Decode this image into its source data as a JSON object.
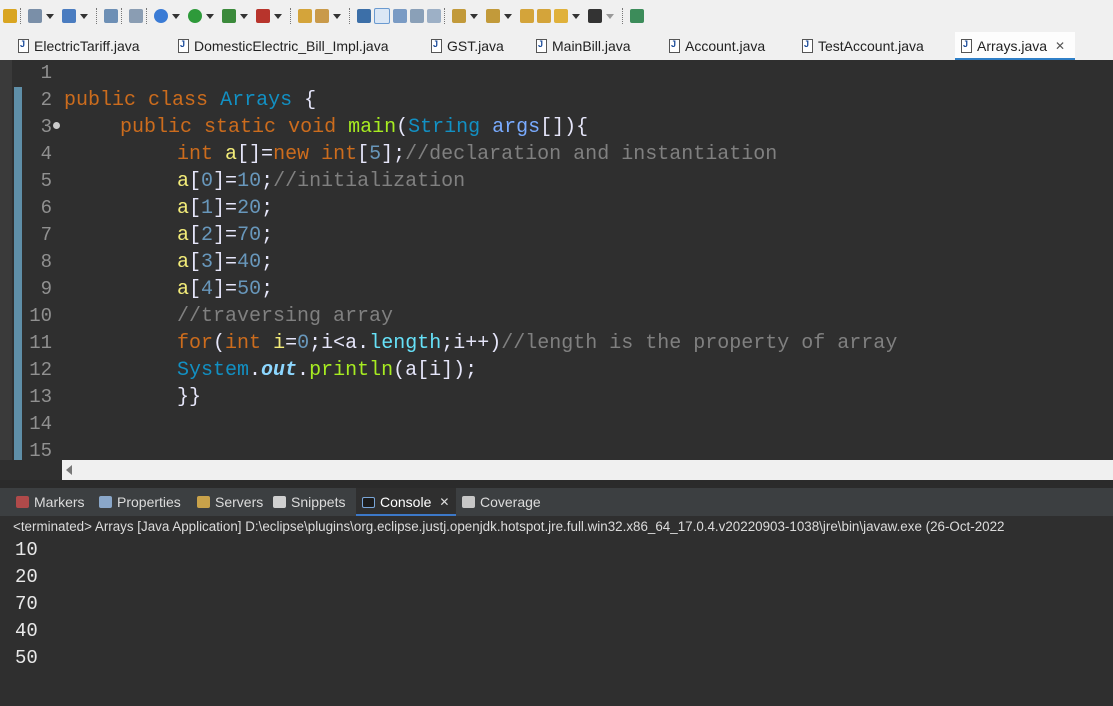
{
  "toolbar": {
    "icons": [
      "toggle-icon",
      "new-icon",
      "publish-icon",
      "server-icon",
      "web-service-icon",
      "debug-icon",
      "run-icon",
      "coverage-icon",
      "external-tools-icon",
      "open-folder-icon",
      "pencil-icon",
      "open-type-icon",
      "highlight-icon",
      "toggle-mark-icon",
      "block-select-icon",
      "pilcrow-icon",
      "next-annotation-icon",
      "prev-annotation-icon",
      "last-edit-icon",
      "back-icon",
      "forward-icon",
      "pin-editor-icon"
    ]
  },
  "editor_tabs": [
    {
      "label": "ElectricTariff.java"
    },
    {
      "label": "DomesticElectric_Bill_Impl.java"
    },
    {
      "label": "GST.java"
    },
    {
      "label": "MainBill.java"
    },
    {
      "label": "Account.java"
    },
    {
      "label": "TestAccount.java"
    },
    {
      "label": "Arrays.java",
      "active": true
    }
  ],
  "editor": {
    "line_numbers": [
      "1",
      "2",
      "3",
      "4",
      "5",
      "6",
      "7",
      "8",
      "9",
      "10",
      "11",
      "12",
      "13",
      "14",
      "15"
    ],
    "code": {
      "l2": {
        "kw1": "public",
        "kw2": "class",
        "name": "Arrays",
        "brace": "{"
      },
      "l3": {
        "kw1": "public",
        "kw2": "static",
        "kw3": "void",
        "method": "main",
        "p1": "(",
        "type": "String",
        "arg": "args",
        "rest": "[]){"
      },
      "l4": {
        "kw1": "int",
        "var": "a",
        "p1": "[]=",
        "kw2": "new",
        "kw3": "int",
        "p2": "[",
        "num": "5",
        "p3": "];",
        "cmt": "//declaration and instantiation"
      },
      "l5": {
        "var": "a",
        "p1": "[",
        "idx": "0",
        "p2": "]=",
        "num": "10",
        "p3": ";",
        "cmt": "//initialization"
      },
      "l6": {
        "var": "a",
        "p1": "[",
        "idx": "1",
        "p2": "]=",
        "num": "20",
        "p3": ";"
      },
      "l7": {
        "var": "a",
        "p1": "[",
        "idx": "2",
        "p2": "]=",
        "num": "70",
        "p3": ";"
      },
      "l8": {
        "var": "a",
        "p1": "[",
        "idx": "3",
        "p2": "]=",
        "num": "40",
        "p3": ";"
      },
      "l9": {
        "var": "a",
        "p1": "[",
        "idx": "4",
        "p2": "]=",
        "num": "50",
        "p3": ";"
      },
      "l10": {
        "cmt": "//traversing array"
      },
      "l11": {
        "kw1": "for",
        "p1": "(",
        "kw2": "int",
        "v1": "i",
        "p2": "=",
        "n0": "0",
        "p3": ";",
        "v2": "i",
        "p4": "<",
        "v3": "a",
        "p5": ".",
        "fld": "length",
        "p6": ";",
        "v4": "i",
        "p7": "++)",
        "cmt": "//length is the property of array"
      },
      "l12": {
        "cls": "System",
        "d1": ".",
        "fld": "out",
        "d2": ".",
        "method": "println",
        "p1": "(",
        "v1": "a",
        "p2": "[",
        "v2": "i",
        "p3": "]);"
      },
      "l13": {
        "text": "}}"
      }
    }
  },
  "views_tabs": [
    {
      "label": "Markers"
    },
    {
      "label": "Properties"
    },
    {
      "label": "Servers"
    },
    {
      "label": "Snippets"
    },
    {
      "label": "Console",
      "active": true
    },
    {
      "label": "Coverage"
    }
  ],
  "console": {
    "description": "<terminated> Arrays [Java Application] D:\\eclipse\\plugins\\org.eclipse.justj.openjdk.hotspot.jre.full.win32.x86_64_17.0.4.v20220903-1038\\jre\\bin\\javaw.exe  (26-Oct-2022",
    "output": [
      "10",
      "20",
      "70",
      "40",
      "50"
    ]
  }
}
